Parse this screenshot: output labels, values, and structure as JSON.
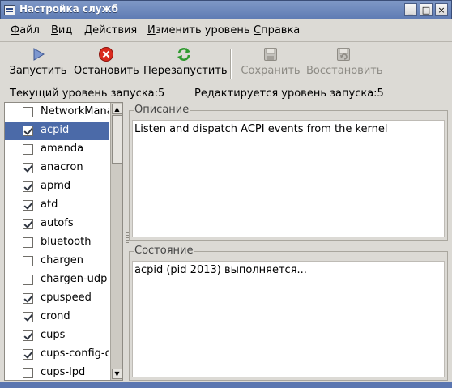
{
  "window": {
    "title": "Настройка служб",
    "controls": {
      "minimize": "_",
      "maximize": "□",
      "close": "×"
    }
  },
  "menu": [
    {
      "label": "Файл",
      "mnemonic": "Ф",
      "rest": "айл"
    },
    {
      "label": "Вид",
      "mnemonic": "В",
      "rest": "ид"
    },
    {
      "label": "Действия",
      "mnemonic": "Д",
      "rest": "ействия"
    },
    {
      "label": "Изменить уровень",
      "mnemonic": "И",
      "rest": "зменить уровень"
    },
    {
      "label": "Справка",
      "mnemonic": "С",
      "rest": "правка"
    }
  ],
  "toolbar": {
    "start": {
      "label": "Запустить",
      "icon": "play-icon",
      "enabled": true
    },
    "stop": {
      "label": "Остановить",
      "icon": "stop-icon",
      "enabled": true
    },
    "restart": {
      "label": "Перезапустить",
      "icon": "restart-icon",
      "enabled": true
    },
    "save": {
      "label": "Сохранить",
      "mnemonic": "х",
      "icon": "save-icon",
      "enabled": false
    },
    "revert": {
      "label": "Восстановить",
      "mnemonic": "о",
      "icon": "revert-icon",
      "enabled": false
    }
  },
  "status": {
    "current_runlevel": "Текущий уровень запуска:5",
    "editing_runlevel": "Редактируется уровень запуска:5"
  },
  "services": [
    {
      "name": "NetworkManager",
      "checked": false,
      "selected": false
    },
    {
      "name": "acpid",
      "checked": true,
      "selected": true
    },
    {
      "name": "amanda",
      "checked": false,
      "selected": false
    },
    {
      "name": "anacron",
      "checked": true,
      "selected": false
    },
    {
      "name": "apmd",
      "checked": true,
      "selected": false
    },
    {
      "name": "atd",
      "checked": true,
      "selected": false
    },
    {
      "name": "autofs",
      "checked": true,
      "selected": false
    },
    {
      "name": "bluetooth",
      "checked": false,
      "selected": false
    },
    {
      "name": "chargen",
      "checked": false,
      "selected": false
    },
    {
      "name": "chargen-udp",
      "checked": false,
      "selected": false
    },
    {
      "name": "cpuspeed",
      "checked": true,
      "selected": false
    },
    {
      "name": "crond",
      "checked": true,
      "selected": false
    },
    {
      "name": "cups",
      "checked": true,
      "selected": false
    },
    {
      "name": "cups-config-daemon",
      "checked": true,
      "selected": false
    },
    {
      "name": "cups-lpd",
      "checked": false,
      "selected": false
    }
  ],
  "description": {
    "label": "Описание",
    "text": "Listen and dispatch ACPI events from the kernel"
  },
  "state": {
    "label": "Состояние",
    "text": "acpid (pid 2013) выполняется..."
  },
  "scrollbar": {
    "up": "▲",
    "down": "▼"
  }
}
